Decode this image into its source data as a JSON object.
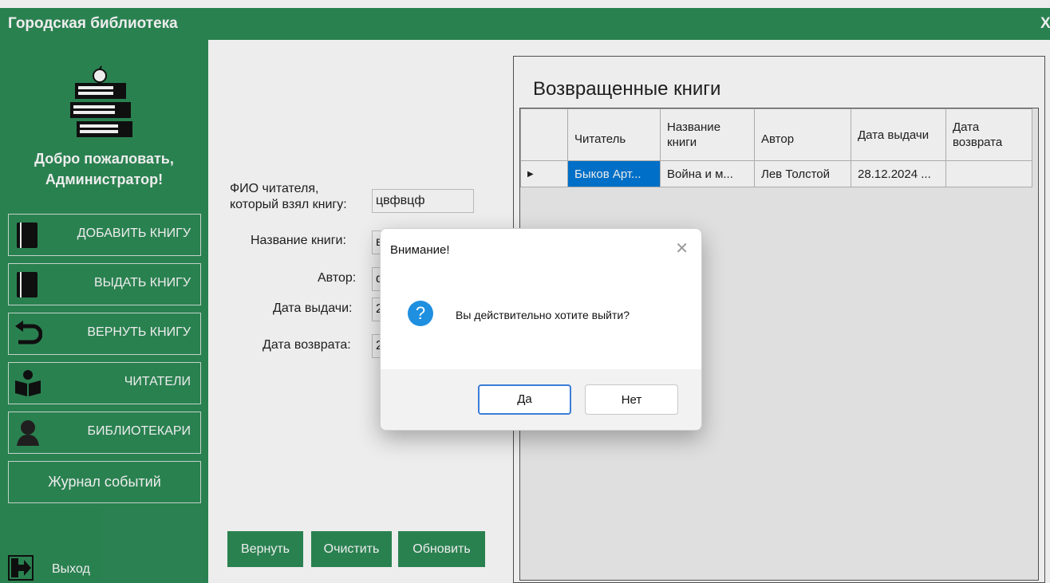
{
  "window": {
    "title": "Городская библиотека",
    "close_label": "X"
  },
  "sidebar": {
    "welcome_line1": "Добро пожаловать,",
    "welcome_line2": "Администратор!",
    "items": [
      {
        "label": "ДОБАВИТЬ КНИГУ",
        "icon": "book-icon"
      },
      {
        "label": "ВЫДАТЬ КНИГУ",
        "icon": "book-icon"
      },
      {
        "label": "ВЕРНУТЬ КНИГУ",
        "icon": "return-arrow-icon"
      },
      {
        "label": "ЧИТАТЕЛИ",
        "icon": "reader-icon"
      },
      {
        "label": "БИБЛИОТЕКАРИ",
        "icon": "user-icon"
      },
      {
        "label": "Журнал событий"
      }
    ],
    "exit_label": "Выход"
  },
  "form": {
    "reader_label_line1": "ФИО читателя,",
    "reader_label_line2": "который взял книгу:",
    "reader_value": "цвфвцф",
    "book_label": "Название книги:",
    "book_value": "в",
    "author_label": "Автор:",
    "author_value": "ф",
    "issue_date_label": "Дата выдачи:",
    "issue_date_value": "2",
    "return_date_label": "Дата возврата:",
    "return_date_value": "2"
  },
  "actions": {
    "return": "Вернуть",
    "clear": "Очистить",
    "refresh": "Обновить"
  },
  "returned_panel": {
    "title": "Возвращенные книги",
    "columns": [
      "Читатель",
      "Название книги",
      "Автор",
      "Дата выдачи",
      "Дата возврата"
    ],
    "rows": [
      [
        "Быков Арт...",
        "Война и м...",
        "Лев Толстой",
        "28.12.2024 ...",
        ""
      ]
    ]
  },
  "dialog": {
    "title": "Внимание!",
    "message": "Вы действительно хотите выйти?",
    "yes": "Да",
    "no": "Нет"
  },
  "colors": {
    "accent": "#2e8b57",
    "selection": "#0078d7",
    "dialog_button_focus": "#3b7dd8"
  }
}
